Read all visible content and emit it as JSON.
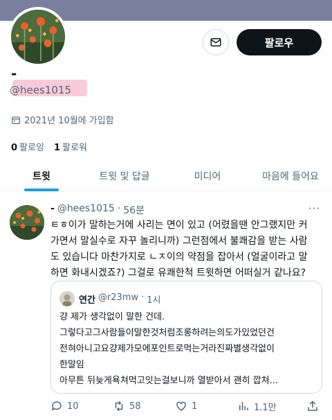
{
  "profile": {
    "display_name": "-",
    "handle": "@hees1015",
    "joined": "2021년 10월에 가입함",
    "following_count": "0",
    "following_label": "팔로잉",
    "followers_count": "1",
    "followers_label": "팔로워",
    "follow_label": "팔로우"
  },
  "tabs": [
    {
      "label": "트윗"
    },
    {
      "label": "트윗 및 답글"
    },
    {
      "label": "미디어"
    },
    {
      "label": "마음에 들어요"
    }
  ],
  "tweet": {
    "name": "-",
    "handle": "@hees1015",
    "sep": "·",
    "time": "56분",
    "more": "···",
    "lines": [
      "ㅌㅎ이가 말하는거에 사리는 면이 있고 (어렸을땐 안그랬지만 커",
      "가면서 말실수로 자꾸 놀리니까) 그런점에서 불쾌감을 받는 사람",
      "도 있습니다 마찬가지로 ㄴㅈ이의 약점을 잡아서 (얼굴이라고 말",
      "하면 화내시겠죠?) 그걸로 유쾌한척 트윗하면 어떠실거 같나요?"
    ],
    "quote": {
      "name": "연간",
      "handle": "@r23mw",
      "sep": "·",
      "time": "1시",
      "lines": [
        "걍 제가 생각없이 말한 건데.",
        "그렇다고그사람들이말한것처럼조롱하려는의도가있었던건",
        "전혀아니고요걍제가모에포인트로먹는거라진짜별생각없이",
        "한말임",
        "아무튼 뒤늦게욕쳐먹고잇는걸보니까 열받아서 괜히 깝쳐..."
      ]
    },
    "replies": "10",
    "retweets": "58",
    "likes": "1",
    "views": "1.1만"
  },
  "colors": {
    "accent": "#1d9bf0",
    "follow_bg": "#0f1419",
    "banner": "#7b7f9e",
    "handle_highlight": "#f7b9cd"
  }
}
